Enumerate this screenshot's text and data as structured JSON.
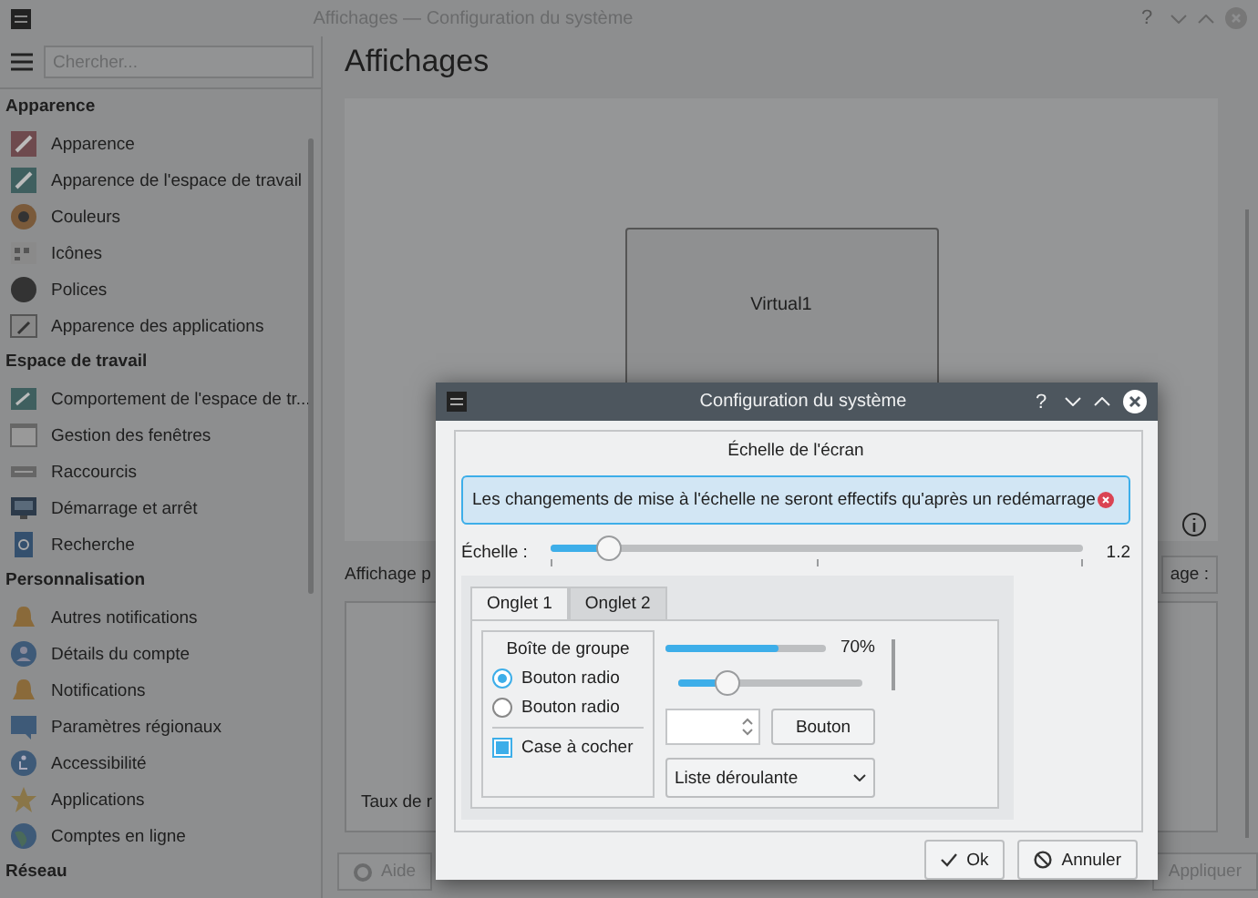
{
  "window": {
    "title": "Affichages — Configuration du système",
    "help_button": "?"
  },
  "sidebar": {
    "search": {
      "placeholder": "Chercher..."
    },
    "sections": [
      {
        "title": "Apparence",
        "items": [
          {
            "label": "Apparence"
          },
          {
            "label": "Apparence de l'espace de travail"
          },
          {
            "label": "Couleurs"
          },
          {
            "label": "Icônes"
          },
          {
            "label": "Polices"
          },
          {
            "label": "Apparence des applications"
          }
        ]
      },
      {
        "title": "Espace de travail",
        "items": [
          {
            "label": "Comportement de l'espace de tr..."
          },
          {
            "label": "Gestion des fenêtres"
          },
          {
            "label": "Raccourcis"
          },
          {
            "label": "Démarrage et arrêt"
          },
          {
            "label": "Recherche"
          }
        ]
      },
      {
        "title": "Personnalisation",
        "items": [
          {
            "label": "Autres notifications"
          },
          {
            "label": "Détails du compte"
          },
          {
            "label": "Notifications"
          },
          {
            "label": "Paramètres régionaux"
          },
          {
            "label": "Accessibilité"
          },
          {
            "label": "Applications"
          },
          {
            "label": "Comptes en ligne"
          }
        ]
      },
      {
        "title": "Réseau"
      }
    ]
  },
  "page": {
    "title": "Affichages",
    "outputs": [
      {
        "name": "Virtual1"
      }
    ],
    "label_1": "Affichage p",
    "button_1": "age :",
    "label_2": "Taux de r",
    "buttons": [
      {
        "label": "Aide",
        "kind": "help"
      },
      {
        "label": "Appliquer",
        "kind": "apply"
      }
    ]
  },
  "dialog": {
    "title": "Configuration du système",
    "help_button": "?",
    "heading": "Échelle de l'écran",
    "message": "Les changements de mise à l'échelle ne seront effectifs qu'après un redémarrage",
    "scale": {
      "label": "Échelle :",
      "level": 0.11,
      "reading": "1.2"
    },
    "tabs": [
      {
        "label": "Onglet 1",
        "selected": true
      },
      {
        "label": "Onglet 2",
        "selected": false
      }
    ],
    "group": {
      "title": "Boîte de groupe",
      "radios": [
        {
          "label": "Bouton radio",
          "selected": true
        },
        {
          "label": "Bouton radio",
          "selected": false
        }
      ],
      "checkbox": {
        "label": "Case à cocher",
        "checked": true
      }
    },
    "progress": {
      "level": 0.7,
      "reading": "70%"
    },
    "slider": {
      "level": 0.27
    },
    "button": "Bouton",
    "combo": {
      "value": "Liste déroulante"
    },
    "buttons": [
      {
        "label": "Ok",
        "kind": "ok"
      },
      {
        "label": "Annuler",
        "kind": "cancel"
      }
    ]
  }
}
